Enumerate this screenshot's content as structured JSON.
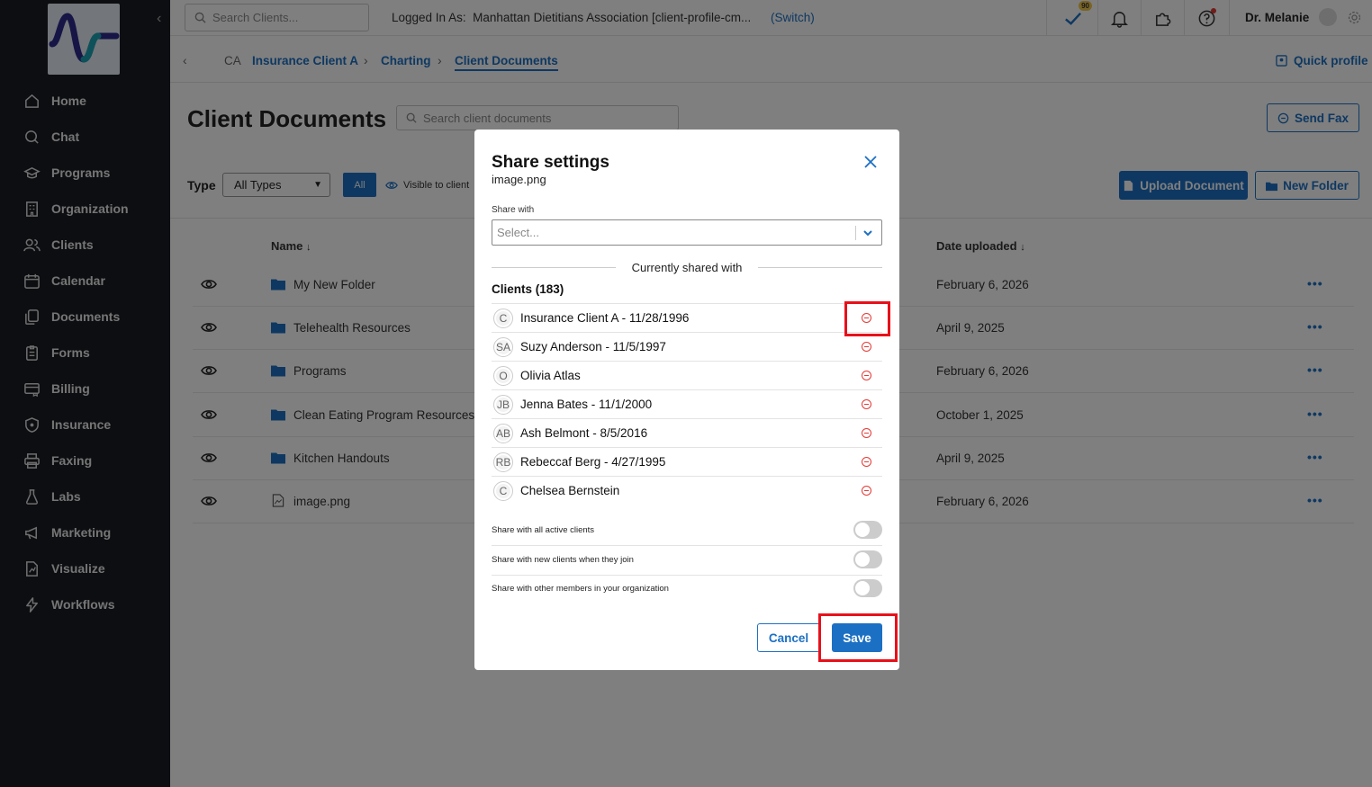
{
  "sidebar": {
    "items": [
      {
        "label": "Home",
        "icon": "home-icon"
      },
      {
        "label": "Chat",
        "icon": "chat-icon"
      },
      {
        "label": "Programs",
        "icon": "graduation-cap-icon"
      },
      {
        "label": "Organization",
        "icon": "building-icon"
      },
      {
        "label": "Clients",
        "icon": "users-icon"
      },
      {
        "label": "Calendar",
        "icon": "calendar-icon"
      },
      {
        "label": "Documents",
        "icon": "documents-icon"
      },
      {
        "label": "Forms",
        "icon": "clipboard-icon"
      },
      {
        "label": "Billing",
        "icon": "billing-icon"
      },
      {
        "label": "Insurance",
        "icon": "shield-icon"
      },
      {
        "label": "Faxing",
        "icon": "printer-icon"
      },
      {
        "label": "Labs",
        "icon": "flask-icon"
      },
      {
        "label": "Marketing",
        "icon": "megaphone-icon"
      },
      {
        "label": "Visualize",
        "icon": "chart-icon"
      },
      {
        "label": "Workflows",
        "icon": "lightning-icon"
      }
    ]
  },
  "topbar": {
    "search_placeholder": "Search Clients...",
    "logged_in_label": "Logged In As:",
    "org_name": "Manhattan Dietitians Association [client-profile-cm...",
    "switch_label": "(Switch)",
    "tasks_badge": "90",
    "user_name": "Dr. Melanie"
  },
  "breadcrumb": {
    "initials": "CA",
    "items": [
      "Insurance Client A",
      "Charting",
      "Client Documents"
    ],
    "quick_profile": "Quick profile"
  },
  "page": {
    "title": "Client Documents",
    "search_placeholder": "Search client documents",
    "send_fax": "Send Fax",
    "type_label": "Type",
    "type_value": "All Types",
    "filter_all": "All",
    "filter_visible": "Visible to client",
    "upload_button": "Upload Document",
    "new_folder_button": "New Folder"
  },
  "table": {
    "col_name": "Name",
    "col_date": "Date uploaded",
    "rows": [
      {
        "name": "My New Folder",
        "date": "February 6, 2026",
        "kind": "folder"
      },
      {
        "name": "Telehealth Resources",
        "date": "April 9, 2025",
        "kind": "folder"
      },
      {
        "name": "Programs",
        "date": "February 6, 2026",
        "kind": "folder"
      },
      {
        "name": "Clean Eating Program Resources",
        "date": "October 1, 2025",
        "kind": "folder"
      },
      {
        "name": "Kitchen Handouts",
        "date": "April 9, 2025",
        "kind": "folder"
      },
      {
        "name": "image.png",
        "date": "February 6, 2026",
        "kind": "file"
      }
    ]
  },
  "modal": {
    "title": "Share settings",
    "subtitle": "image.png",
    "share_with_label": "Share with",
    "select_placeholder": "Select...",
    "currently_shared": "Currently shared with",
    "clients_heading": "Clients (183)",
    "clients": [
      {
        "initials": "C",
        "name": "Insurance Client A - 11/28/1996"
      },
      {
        "initials": "SA",
        "name": "Suzy Anderson - 11/5/1997"
      },
      {
        "initials": "O",
        "name": "Olivia Atlas"
      },
      {
        "initials": "JB",
        "name": "Jenna Bates - 11/1/2000"
      },
      {
        "initials": "AB",
        "name": "Ash Belmont - 8/5/2016"
      },
      {
        "initials": "RB",
        "name": "Rebeccaf Berg - 4/27/1995"
      },
      {
        "initials": "C",
        "name": "Chelsea Bernstein"
      }
    ],
    "toggles": [
      {
        "label": "Share with all active clients",
        "on": false
      },
      {
        "label": "Share with new clients when they join",
        "on": false
      },
      {
        "label": "Share with other members in your organization",
        "on": false
      }
    ],
    "cancel": "Cancel",
    "save": "Save"
  },
  "colors": {
    "accent": "#1c70c4",
    "sidebar_bg": "#1a1d23",
    "remove_red": "#e53935",
    "highlight": "#e8101a"
  }
}
